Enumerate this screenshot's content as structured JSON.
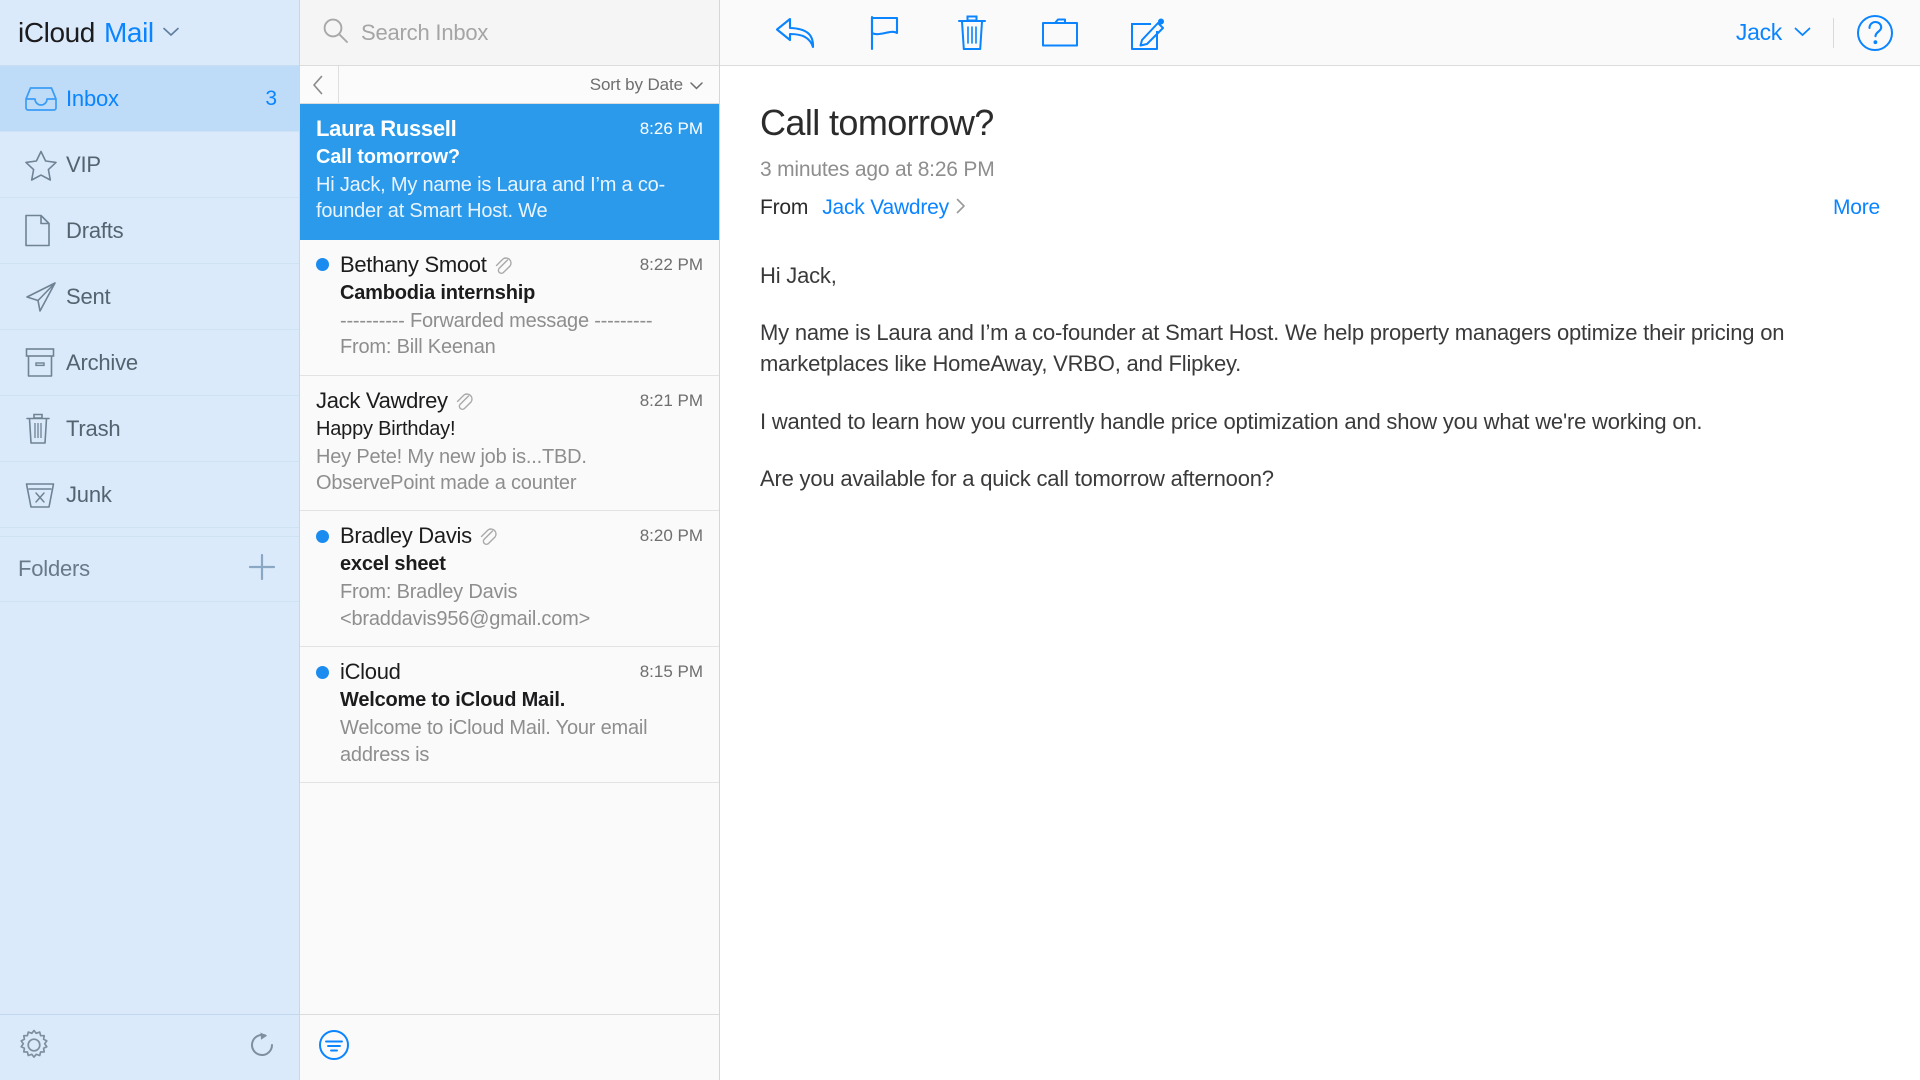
{
  "brand": {
    "icloud": "iCloud",
    "app": "Mail",
    "caret": "chevron-down"
  },
  "sidebar": {
    "items": [
      {
        "label": "Inbox",
        "icon": "inbox-icon",
        "badge": "3",
        "active": true
      },
      {
        "label": "VIP",
        "icon": "star-icon",
        "badge": "",
        "active": false
      },
      {
        "label": "Drafts",
        "icon": "document-icon",
        "badge": "",
        "active": false
      },
      {
        "label": "Sent",
        "icon": "paper-plane-icon",
        "badge": "",
        "active": false
      },
      {
        "label": "Archive",
        "icon": "archive-box-icon",
        "badge": "",
        "active": false
      },
      {
        "label": "Trash",
        "icon": "trash-icon",
        "badge": "",
        "active": false
      },
      {
        "label": "Junk",
        "icon": "junk-icon",
        "badge": "",
        "active": false
      }
    ],
    "folders_title": "Folders",
    "add_folder_icon": "plus-icon",
    "settings_icon": "gear-icon",
    "refresh_icon": "refresh-icon"
  },
  "search": {
    "placeholder": "Search Inbox",
    "value": "",
    "icon": "search-icon"
  },
  "list_header": {
    "back_icon": "chevron-left-icon",
    "sort_label": "Sort by Date",
    "sort_caret": "chevron-down-icon"
  },
  "list_footer": {
    "filter_icon": "filter-icon"
  },
  "messages": [
    {
      "sender": "Laura Russell",
      "time": "8:26 PM",
      "subject": "Call tomorrow?",
      "preview": "Hi Jack, My name is Laura and I’m a co-founder at Smart Host. We",
      "selected": true,
      "unread": false,
      "attachment": false
    },
    {
      "sender": "Bethany Smoot",
      "time": "8:22 PM",
      "subject": "Cambodia internship",
      "preview": "---------- Forwarded message --------- From: Bill Keenan",
      "selected": false,
      "unread": true,
      "attachment": true
    },
    {
      "sender": "Jack Vawdrey",
      "time": "8:21 PM",
      "subject": "Happy Birthday!",
      "preview": "Hey Pete! My new job is...TBD. ObservePoint made a counter",
      "selected": false,
      "unread": false,
      "attachment": true
    },
    {
      "sender": "Bradley Davis",
      "time": "8:20 PM",
      "subject": "excel sheet",
      "preview": "From: Bradley Davis <braddavis956@gmail.com>",
      "selected": false,
      "unread": true,
      "attachment": true
    },
    {
      "sender": "iCloud",
      "time": "8:15 PM",
      "subject": "Welcome to iCloud Mail.",
      "preview": "Welcome to iCloud Mail. Your email address is",
      "selected": false,
      "unread": true,
      "attachment": false
    }
  ],
  "toolbar": {
    "reply_icon": "reply-arrow-icon",
    "flag_icon": "flag-icon",
    "delete_icon": "trash-icon",
    "move_icon": "folder-icon",
    "compose_icon": "compose-icon",
    "account_name": "Jack",
    "account_caret": "chevron-down-icon",
    "help_icon": "question-mark-circle-icon"
  },
  "mail": {
    "subject": "Call tomorrow?",
    "date": "3 minutes ago at 8:26 PM",
    "from_label": "From",
    "from_name": "Jack Vawdrey",
    "from_chevron": "chevron-right-icon",
    "more_label": "More",
    "body": [
      "Hi Jack,",
      "My name is Laura and I’m a co-founder at Smart Host. We help property managers optimize their pricing on marketplaces like HomeAway, VRBO, and Flipkey.",
      "I wanted to learn how you currently handle price optimization and show you what we're working on.",
      "Are you available for a quick call tomorrow afternoon?"
    ]
  },
  "colors": {
    "accent": "#0a84ff",
    "selected_row": "#2b9aeb",
    "sidebar_bg": "#dbeafb",
    "sidebar_active": "#bedcf8",
    "unread_dot": "#1a8cf0"
  }
}
